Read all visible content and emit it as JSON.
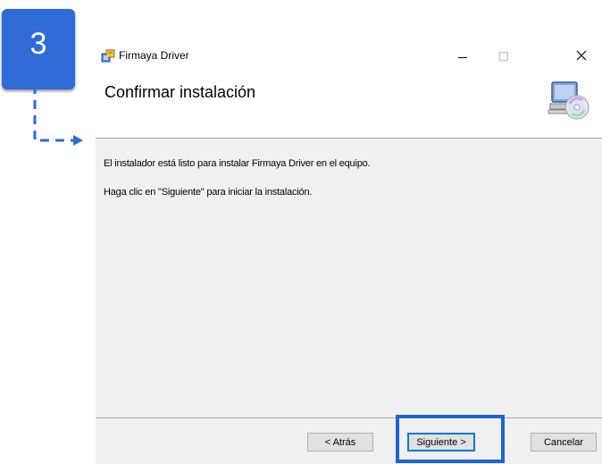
{
  "window": {
    "title": "Firmaya Driver",
    "controls": [
      "minimize",
      "maximize",
      "close"
    ]
  },
  "header": {
    "heading": "Confirmar instalación",
    "icon": "computer-disc-icon"
  },
  "body": {
    "line1": "El instalador está listo para instalar Firmaya Driver en el equipo.",
    "line2": "Haga clic en \"Siguiente\" para iniciar la instalación."
  },
  "footer": {
    "back_label": "< Atrás",
    "next_label": "Siguiente >",
    "cancel_label": "Cancelar"
  },
  "annotation": {
    "step_number": "3",
    "accent_color": "#2e6bd6"
  }
}
